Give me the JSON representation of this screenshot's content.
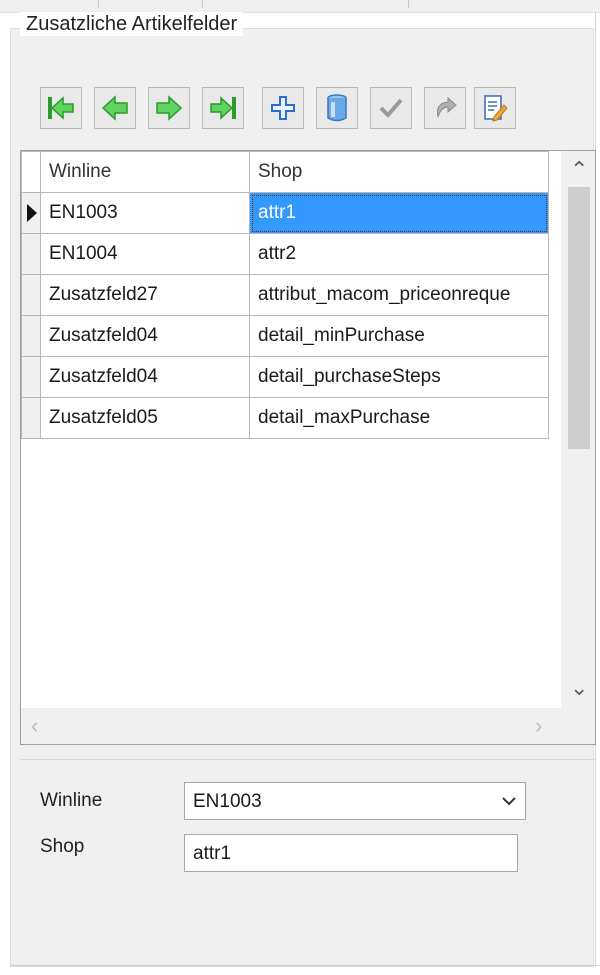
{
  "group_title": "Zusatzliche Artikelfelder",
  "toolbar": {
    "buttons": [
      {
        "name": "first-record",
        "icon": "first-record-icon",
        "enabled": true
      },
      {
        "name": "previous-record",
        "icon": "previous-record-icon",
        "enabled": true
      },
      {
        "name": "next-record",
        "icon": "next-record-icon",
        "enabled": true
      },
      {
        "name": "last-record",
        "icon": "last-record-icon",
        "enabled": true
      },
      {
        "name": "add-record",
        "icon": "plus-icon",
        "enabled": true
      },
      {
        "name": "delete-record",
        "icon": "trash-icon",
        "enabled": true
      },
      {
        "name": "confirm",
        "icon": "checkmark-icon",
        "enabled": false
      },
      {
        "name": "undo",
        "icon": "undo-icon",
        "enabled": false
      },
      {
        "name": "edit",
        "icon": "edit-icon",
        "enabled": true
      }
    ]
  },
  "grid": {
    "columns": [
      "Winline",
      "Shop"
    ],
    "rows": [
      {
        "winline": "EN1003",
        "shop": "attr1",
        "current": true
      },
      {
        "winline": "EN1004",
        "shop": "attr2",
        "current": false
      },
      {
        "winline": "Zusatzfeld27",
        "shop": "attribut_macom_priceonreque",
        "current": false
      },
      {
        "winline": "Zusatzfeld04",
        "shop": "detail_minPurchase",
        "current": false
      },
      {
        "winline": "Zusatzfeld04",
        "shop": "detail_purchaseSteps",
        "current": false
      },
      {
        "winline": "Zusatzfeld05",
        "shop": "detail_maxPurchase",
        "current": false
      }
    ]
  },
  "form": {
    "winline_label": "Winline",
    "winline_value": "EN1003",
    "shop_label": "Shop",
    "shop_value": "attr1"
  },
  "colors": {
    "selection": "#3399ff",
    "nav_green": "#3cb83c",
    "panel": "#f0f0f0"
  }
}
